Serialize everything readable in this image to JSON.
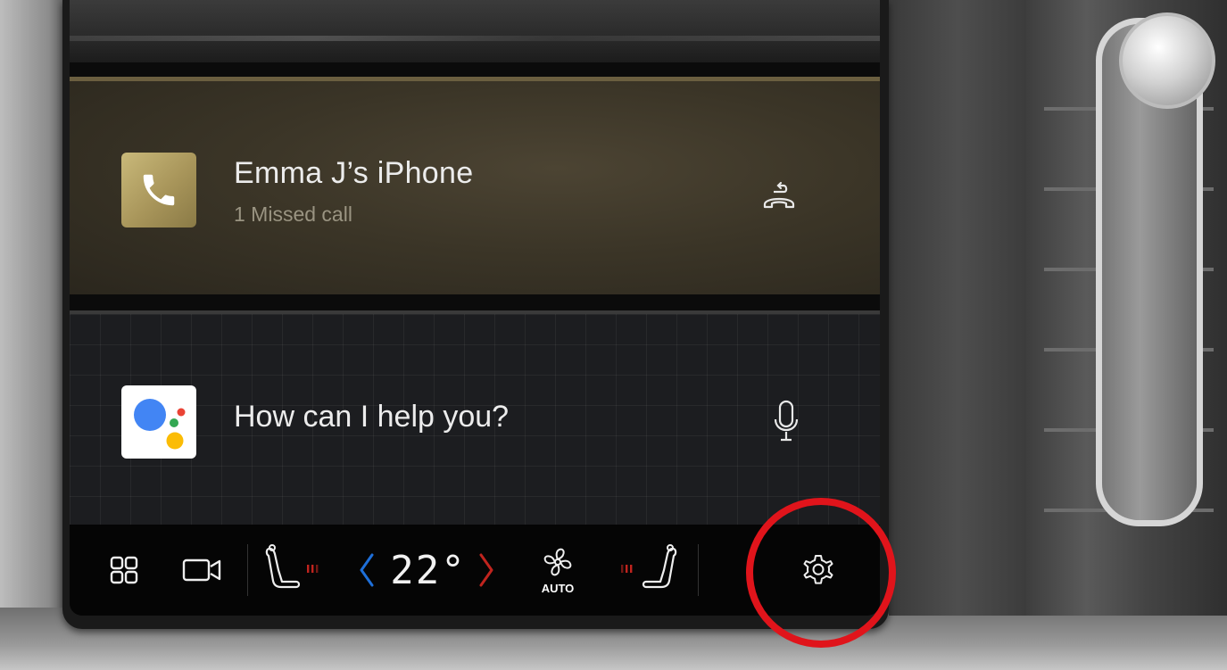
{
  "phone_card": {
    "title": "Emma J’s iPhone",
    "subtitle": "1 Missed call"
  },
  "assistant_card": {
    "prompt": "How can I help you?"
  },
  "climate_bar": {
    "temperature": "22°",
    "fan_mode": "AUTO"
  },
  "icons": [
    "apps-grid-icon",
    "camera-icon",
    "driver-seat-heat-icon",
    "temp-decrease-icon",
    "temp-increase-icon",
    "fan-icon",
    "passenger-seat-heat-icon",
    "settings-gear-icon",
    "phone-icon",
    "callback-icon",
    "google-assistant-icon",
    "microphone-icon"
  ],
  "colors": {
    "phone_card_gold": "#a8955a",
    "temp_down_blue": "#1e6fd9",
    "temp_up_red": "#c0241e",
    "seat_heat_red": "#c0241e",
    "highlight_red": "#e0141b",
    "ga_blue": "#4285F4",
    "ga_red": "#EA4335",
    "ga_yellow": "#FBBC05",
    "ga_green": "#34A853"
  }
}
